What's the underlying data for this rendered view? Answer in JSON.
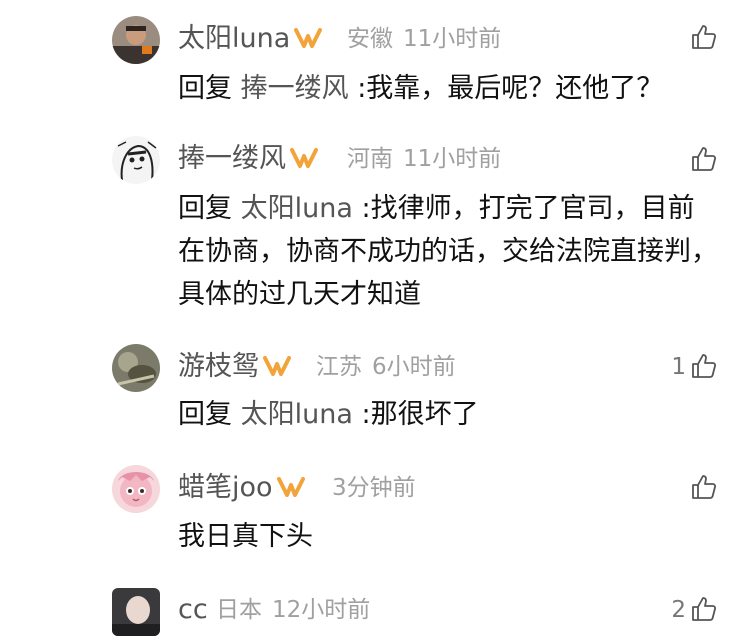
{
  "comments": [
    {
      "username": "太阳luna",
      "location": "安徽",
      "time": "11小时前",
      "like_count": "",
      "reply_prefix": "回复",
      "reply_to": "捧一缕风",
      "text": ":我靠，最后呢？还他了？",
      "avatar_icon": "avatar-man-photo-icon"
    },
    {
      "username": "捧一缕风",
      "location": "河南",
      "time": "11小时前",
      "like_count": "",
      "reply_prefix": "回复",
      "reply_to": "太阳luna",
      "text": ":找律师，打完了官司，目前在协商，协商不成功的话，交给法院直接判，具体的过几天才知道",
      "avatar_icon": "avatar-sketch-girl-icon"
    },
    {
      "username": "游枝鸳",
      "location": "江苏",
      "time": "6小时前",
      "like_count": "1",
      "reply_prefix": "回复",
      "reply_to": "太阳luna",
      "text": ":那很坏了",
      "avatar_icon": "avatar-photo-icon"
    },
    {
      "username": "蜡笔joo",
      "location": "",
      "time": "3分钟前",
      "like_count": "",
      "reply_prefix": "",
      "reply_to": "",
      "text": "我日真下头",
      "avatar_icon": "avatar-pink-cartoon-icon"
    },
    {
      "username": "cc",
      "location": "日本",
      "time": "12小时前",
      "like_count": "2",
      "reply_prefix": "",
      "reply_to": "",
      "text": "",
      "avatar_icon": "avatar-blurred-photo-icon"
    }
  ],
  "icons": {
    "badge": "vip-badge-icon",
    "like": "thumbs-up-icon"
  },
  "colors": {
    "badge_orange": "#f2a33a",
    "username_gray": "#555555",
    "meta_gray": "#a0a0a0"
  }
}
